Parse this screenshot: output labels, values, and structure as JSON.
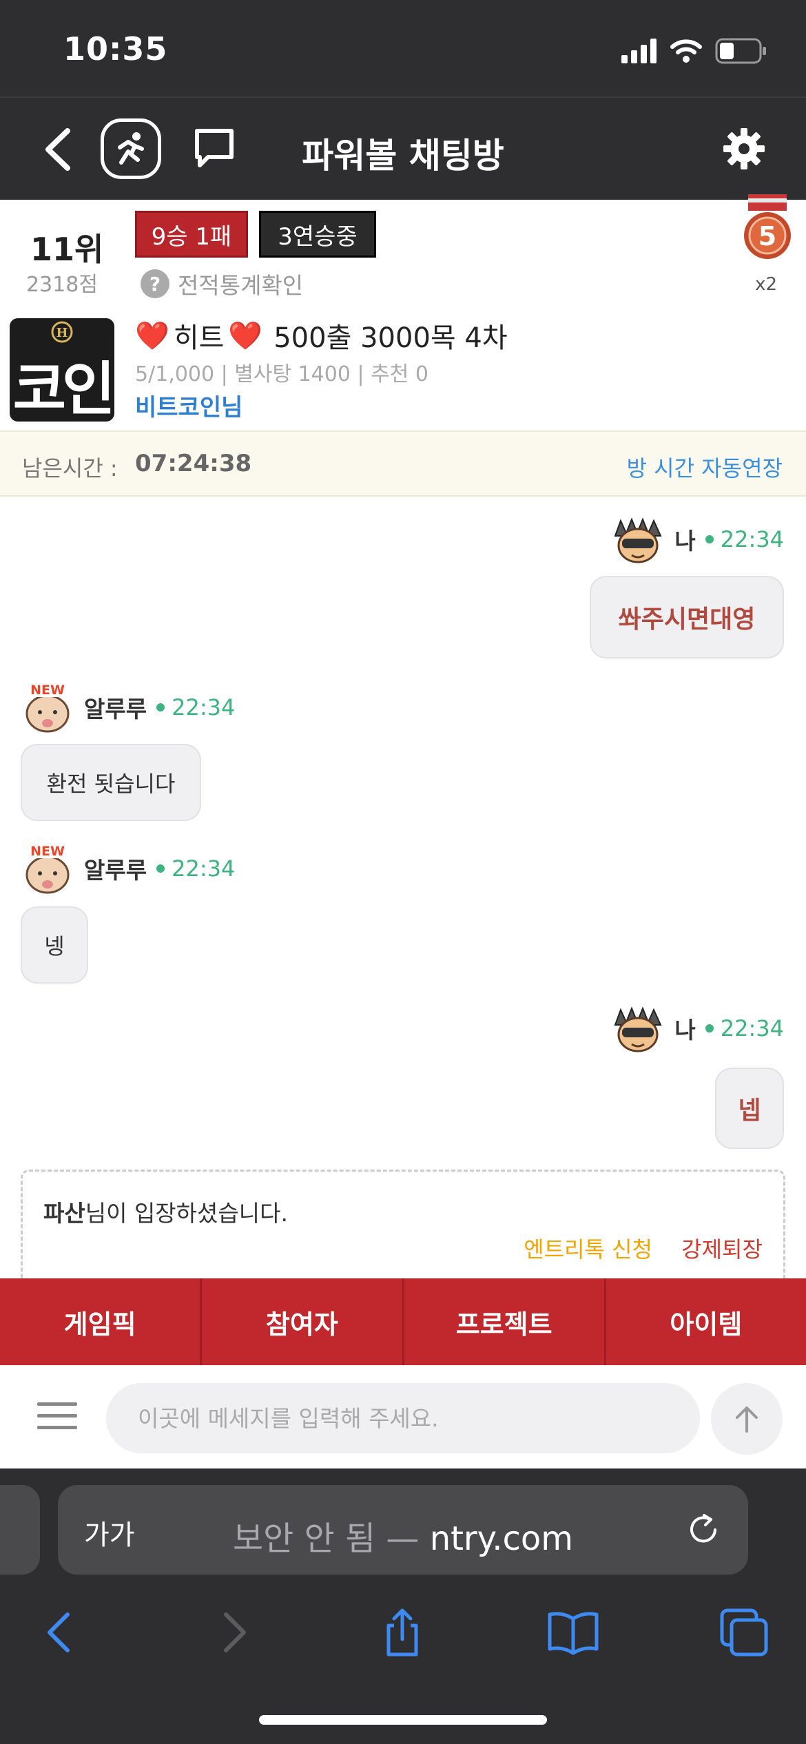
{
  "status": {
    "time": "10:35"
  },
  "header": {
    "title": "파워볼 채팅방"
  },
  "profile": {
    "rank": "11위",
    "points": "2318점",
    "record_badge": "9승 1패",
    "streak_badge": "3연승중",
    "stats_link": "전적통계확인",
    "medal_number": "5",
    "medal_multiplier": "x2",
    "avatar_text": "코인",
    "avatar_letter": "H",
    "room_name_heart": "❤️",
    "room_name_word": "히트",
    "room_name_rest": "500출 3000목 4차",
    "room_meta": "5/1,000 | 별사탕 1400 | 추천 0",
    "owner": "비트코인님"
  },
  "timer": {
    "label": "남은시간 :",
    "value": "07:24:38",
    "extend_label": "방 시간 자동연장"
  },
  "messages": [
    {
      "sender": "나",
      "time": "22:34",
      "text": "쏴주시면대영"
    },
    {
      "sender": "알루루",
      "badge": "NEW",
      "time": "22:34",
      "text": "환전 됫습니다"
    },
    {
      "sender": "알루루",
      "badge": "NEW",
      "time": "22:34",
      "text": "넹"
    },
    {
      "sender": "나",
      "time": "22:34",
      "text": "넵"
    }
  ],
  "notice": {
    "user": "파산",
    "text": "님이 입장하셨습니다.",
    "action_entry": "엔트리톡 신청",
    "action_kick": "강제퇴장"
  },
  "tabs": [
    "게임픽",
    "참여자",
    "프로젝트",
    "아이템"
  ],
  "input": {
    "placeholder": "이곳에 메세지를 입력해 주세요."
  },
  "browser": {
    "aa": "가가",
    "security": "보안 안 됨 —",
    "domain": "ntry.com"
  },
  "colors": {
    "accent_red": "#c0282d",
    "online_green": "#3db37f",
    "link_blue": "#2f7fd1"
  }
}
